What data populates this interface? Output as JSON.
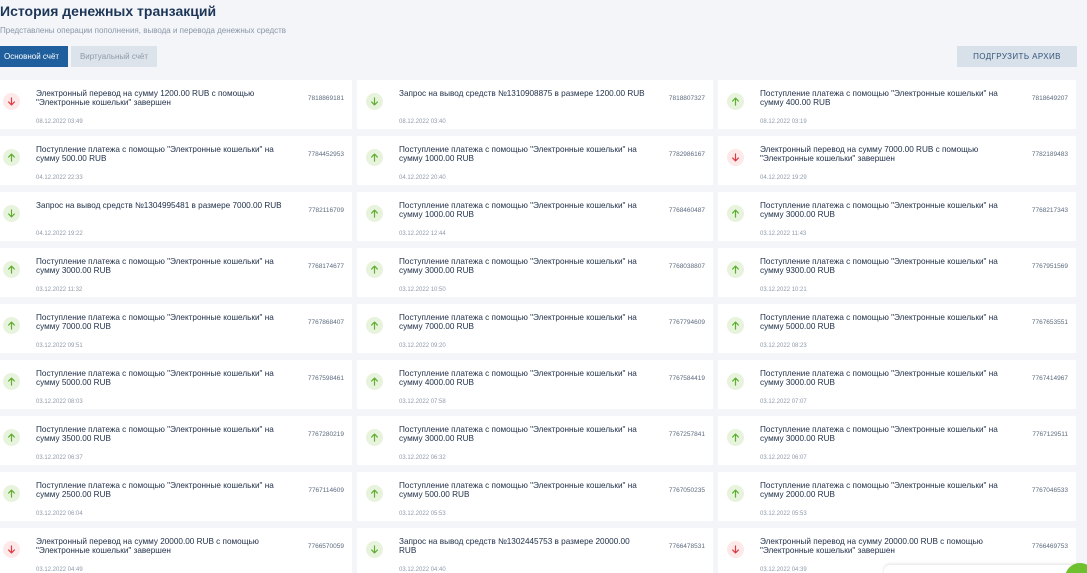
{
  "header": {
    "title": "История денежных транзакций",
    "subtitle": "Представлены операции пополнения, вывода и перевода денежных средств"
  },
  "tabs": [
    {
      "label": "Основной счёт",
      "active": true
    },
    {
      "label": "Виртуальный счёт",
      "active": false
    }
  ],
  "toolbar": {
    "archive_label": "ПОДГРУЗИТЬ АРХИВ"
  },
  "colors": {
    "incoming": "#5fae2e",
    "outgoing": "#e0383f",
    "accent": "#1f5f9e"
  },
  "transactions": [
    {
      "icon": "arrow-down-red-icon",
      "type": "out",
      "description": "Электронный перевод на сумму 1200.00 RUB с помощью \"Электронные кошельки\" завершен",
      "date": "08.12.2022 03:49",
      "id": "7818869181"
    },
    {
      "icon": "arrow-down-green-icon",
      "type": "in",
      "description": "Запрос на вывод средств №1310908875 в размере 1200.00 RUB",
      "date": "08.12.2022 03:40",
      "id": "7818807327"
    },
    {
      "icon": "arrow-up-green-icon",
      "type": "in",
      "description": "Поступление платежа с помощью \"Электронные кошельки\" на сумму 400.00 RUB",
      "date": "08.12.2022 03:19",
      "id": "7818649207"
    },
    {
      "icon": "arrow-up-green-icon",
      "type": "in",
      "description": "Поступление платежа с помощью \"Электронные кошельки\" на сумму 500.00 RUB",
      "date": "04.12.2022 22:33",
      "id": "7784452953"
    },
    {
      "icon": "arrow-up-green-icon",
      "type": "in",
      "description": "Поступление платежа с помощью \"Электронные кошельки\" на сумму 1000.00 RUB",
      "date": "04.12.2022 20:40",
      "id": "7782986167"
    },
    {
      "icon": "arrow-down-red-icon",
      "type": "out",
      "description": "Электронный перевод на сумму 7000.00 RUB с помощью \"Электронные кошельки\" завершен",
      "date": "04.12.2022 19:29",
      "id": "7782189483"
    },
    {
      "icon": "arrow-down-green-icon",
      "type": "in",
      "description": "Запрос на вывод средств №1304995481 в размере 7000.00 RUB",
      "date": "04.12.2022 19:22",
      "id": "7782116709"
    },
    {
      "icon": "arrow-up-green-icon",
      "type": "in",
      "description": "Поступление платежа с помощью \"Электронные кошельки\" на сумму 1000.00 RUB",
      "date": "03.12.2022 12:44",
      "id": "7768460487"
    },
    {
      "icon": "arrow-up-green-icon",
      "type": "in",
      "description": "Поступление платежа с помощью \"Электронные кошельки\" на сумму 3000.00 RUB",
      "date": "03.12.2022 11:43",
      "id": "7768217343"
    },
    {
      "icon": "arrow-up-green-icon",
      "type": "in",
      "description": "Поступление платежа с помощью \"Электронные кошельки\" на сумму 3000.00 RUB",
      "date": "03.12.2022 11:32",
      "id": "7768174677"
    },
    {
      "icon": "arrow-up-green-icon",
      "type": "in",
      "description": "Поступление платежа с помощью \"Электронные кошельки\" на сумму 3000.00 RUB",
      "date": "03.12.2022 10:50",
      "id": "7768038807"
    },
    {
      "icon": "arrow-up-green-icon",
      "type": "in",
      "description": "Поступление платежа с помощью \"Электронные кошельки\" на сумму 9300.00 RUB",
      "date": "03.12.2022 10:21",
      "id": "7767951569"
    },
    {
      "icon": "arrow-up-green-icon",
      "type": "in",
      "description": "Поступление платежа с помощью \"Электронные кошельки\" на сумму 7000.00 RUB",
      "date": "03.12.2022 09:51",
      "id": "7767868407"
    },
    {
      "icon": "arrow-up-green-icon",
      "type": "in",
      "description": "Поступление платежа с помощью \"Электронные кошельки\" на сумму 7000.00 RUB",
      "date": "03.12.2022 09:20",
      "id": "7767794609"
    },
    {
      "icon": "arrow-up-green-icon",
      "type": "in",
      "description": "Поступление платежа с помощью \"Электронные кошельки\" на сумму 5000.00 RUB",
      "date": "03.12.2022 08:23",
      "id": "7767653551"
    },
    {
      "icon": "arrow-up-green-icon",
      "type": "in",
      "description": "Поступление платежа с помощью \"Электронные кошельки\" на сумму 5000.00 RUB",
      "date": "03.12.2022 08:03",
      "id": "7767598461"
    },
    {
      "icon": "arrow-up-green-icon",
      "type": "in",
      "description": "Поступление платежа с помощью \"Электронные кошельки\" на сумму 4000.00 RUB",
      "date": "03.12.2022 07:58",
      "id": "7767584419"
    },
    {
      "icon": "arrow-up-green-icon",
      "type": "in",
      "description": "Поступление платежа с помощью \"Электронные кошельки\" на сумму 3000.00 RUB",
      "date": "03.12.2022 07:07",
      "id": "7767414967"
    },
    {
      "icon": "arrow-up-green-icon",
      "type": "in",
      "description": "Поступление платежа с помощью \"Электронные кошельки\" на сумму 3500.00 RUB",
      "date": "03.12.2022 06:37",
      "id": "7767280219"
    },
    {
      "icon": "arrow-up-green-icon",
      "type": "in",
      "description": "Поступление платежа с помощью \"Электронные кошельки\" на сумму 3000.00 RUB",
      "date": "03.12.2022 06:32",
      "id": "7767257841"
    },
    {
      "icon": "arrow-up-green-icon",
      "type": "in",
      "description": "Поступление платежа с помощью \"Электронные кошельки\" на сумму 3000.00 RUB",
      "date": "03.12.2022 06:07",
      "id": "7767129511"
    },
    {
      "icon": "arrow-up-green-icon",
      "type": "in",
      "description": "Поступление платежа с помощью \"Электронные кошельки\" на сумму 2500.00 RUB",
      "date": "03.12.2022 06:04",
      "id": "7767114609"
    },
    {
      "icon": "arrow-up-green-icon",
      "type": "in",
      "description": "Поступление платежа с помощью \"Электронные кошельки\" на сумму 500.00 RUB",
      "date": "03.12.2022 05:53",
      "id": "7767050235"
    },
    {
      "icon": "arrow-up-green-icon",
      "type": "in",
      "description": "Поступление платежа с помощью \"Электронные кошельки\" на сумму 2000.00 RUB",
      "date": "03.12.2022 05:53",
      "id": "7767046533"
    },
    {
      "icon": "arrow-down-red-icon",
      "type": "out",
      "description": "Электронный перевод на сумму 20000.00 RUB с помощью \"Электронные кошельки\" завершен",
      "date": "03.12.2022 04:49",
      "id": "7766570059"
    },
    {
      "icon": "arrow-down-green-icon",
      "type": "in",
      "description": "Запрос на вывод средств №1302445753 в размере 20000.00 RUB",
      "date": "03.12.2022 04:40",
      "id": "7766478531"
    },
    {
      "icon": "arrow-down-red-icon",
      "type": "out",
      "description": "Электронный перевод на сумму 20000.00 RUB с помощью \"Электронные кошельки\" завершен",
      "date": "03.12.2022 04:39",
      "id": "7766469753"
    }
  ]
}
